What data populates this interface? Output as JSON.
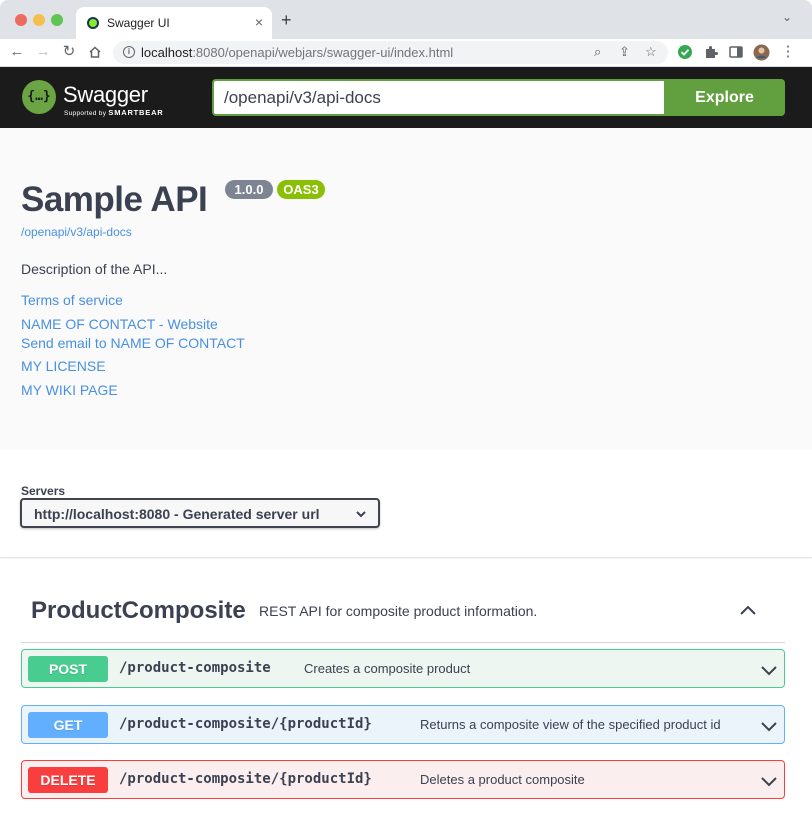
{
  "browser": {
    "tab_title": "Swagger UI",
    "tab_close": "×",
    "new_tab": "+",
    "url_host": "localhost",
    "url_rest": ":8080/openapi/webjars/swagger-ui/index.html"
  },
  "swagger": {
    "logo_text": "Swagger",
    "logo_sub_prefix": "Supported by",
    "logo_sub_brand": "SMARTBEAR",
    "url_value": "/openapi/v3/api-docs",
    "explore_label": "Explore",
    "brand_color": "#62a03f"
  },
  "info": {
    "title": "Sample API",
    "version": "1.0.0",
    "oas_badge": "OAS3",
    "spec_url": "/openapi/v3/api-docs",
    "description": "Description of the API...",
    "links": [
      "Terms of service",
      "NAME OF CONTACT - Website",
      "Send email to NAME OF CONTACT",
      "MY LICENSE",
      "MY WIKI PAGE"
    ]
  },
  "servers": {
    "label": "Servers",
    "selected": "http://localhost:8080 - Generated server url"
  },
  "tag": {
    "name": "ProductComposite",
    "description": "REST API for composite product information."
  },
  "operations": [
    {
      "method": "POST",
      "path": "/product-composite",
      "summary": "Creates a composite product",
      "color": "#49cc90"
    },
    {
      "method": "GET",
      "path": "/product-composite/{productId}",
      "summary": "Returns a composite view of the specified product id",
      "color": "#61affe"
    },
    {
      "method": "DELETE",
      "path": "/product-composite/{productId}",
      "summary": "Deletes a product composite",
      "color": "#f93e3e"
    }
  ]
}
